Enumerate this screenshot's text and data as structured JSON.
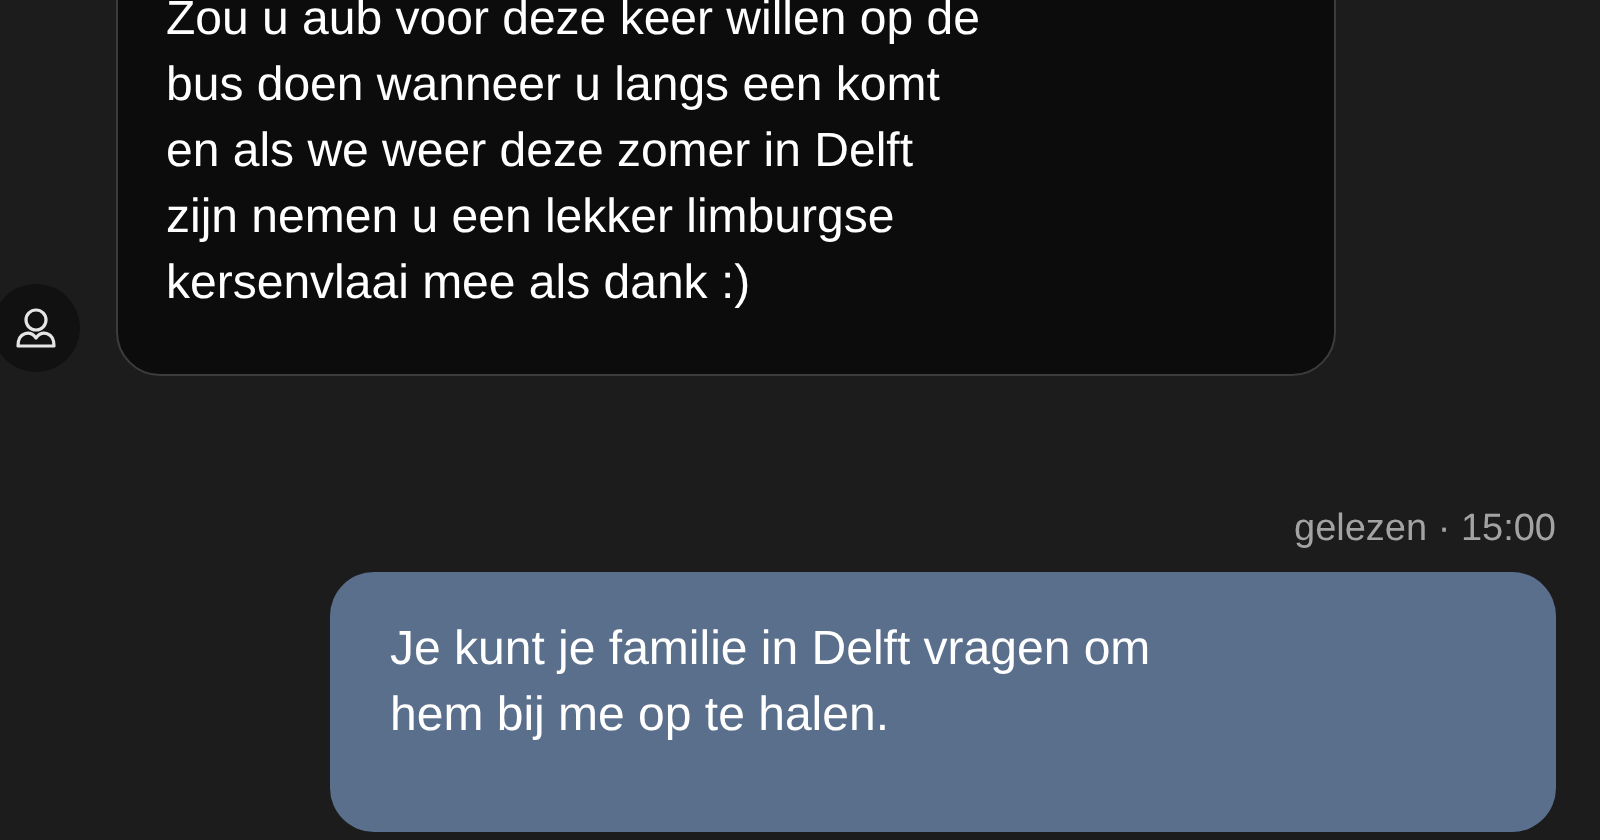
{
  "messages": [
    {
      "kind": "incoming",
      "lines": [
        "Zou u aub voor deze keer willen op de",
        "bus doen wanneer u langs een komt",
        "en als we weer deze zomer in Delft",
        "zijn nemen u een lekker limburgse",
        "kersenvlaai mee als dank :)"
      ]
    },
    {
      "kind": "status",
      "text": "gelezen · 15:00"
    },
    {
      "kind": "outgoing",
      "lines": [
        "Je kunt je familie in Delft vragen om",
        "hem bij me op te halen."
      ]
    }
  ]
}
